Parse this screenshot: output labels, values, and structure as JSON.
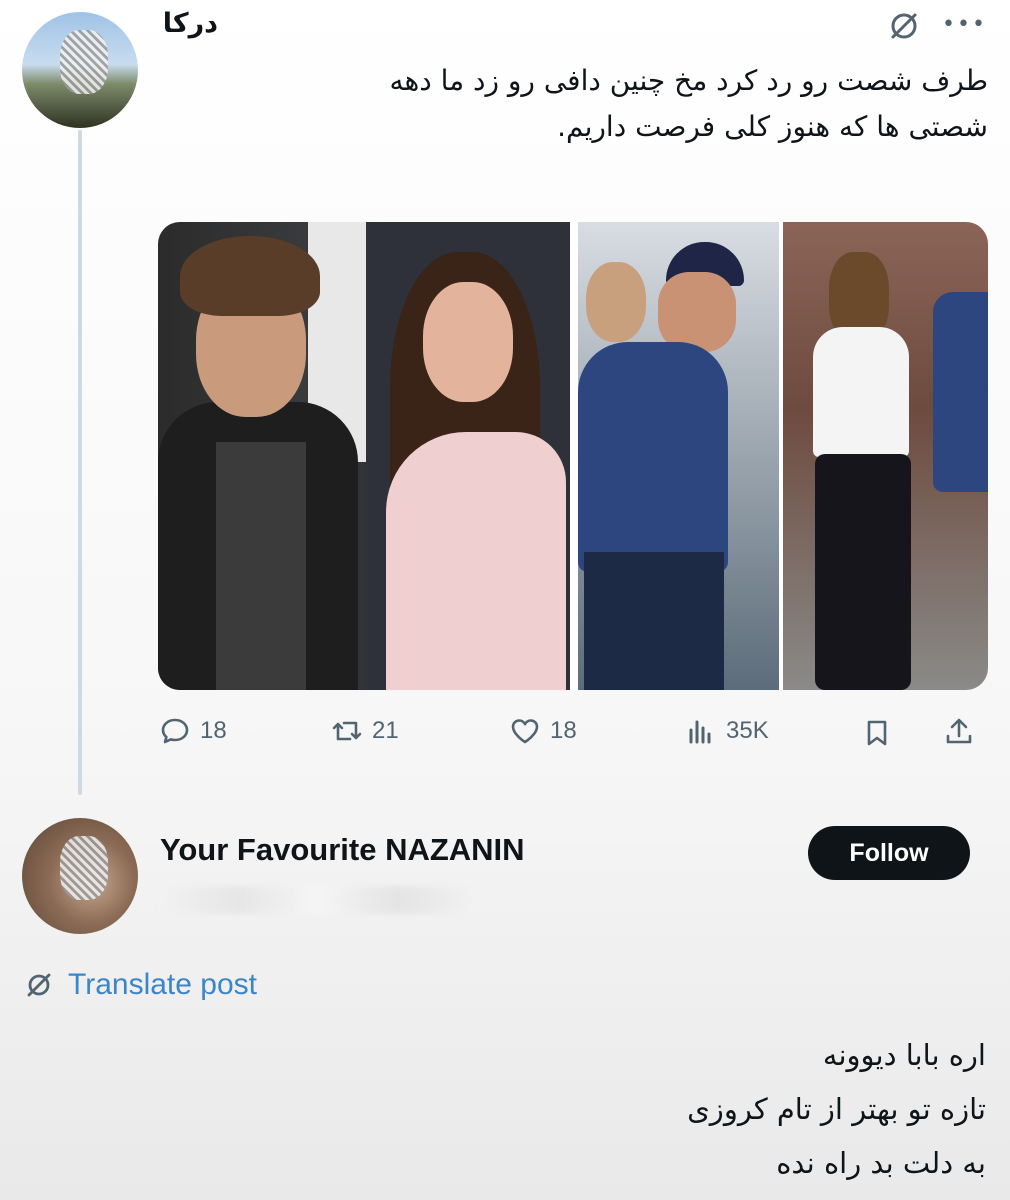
{
  "tweet": {
    "author_name": "درکا",
    "text_line_1": "طرف شصت رو رد کرد مخ چنین دافی رو زد ما دهه",
    "text_line_2": "شصتی ها که هنوز کلی فرصت داریم.",
    "stats": {
      "replies": "18",
      "reposts": "21",
      "likes": "18",
      "views": "35K"
    }
  },
  "reply": {
    "author_name": "Your Favourite NAZANIN",
    "follow_label": "Follow",
    "translate_label": "Translate post",
    "text_lines": [
      "اره بابا دیوونه",
      "تازه تو بهتر از تام کروزی",
      "به دلت بد راه نده"
    ]
  },
  "icons": {
    "grok": "grok-icon",
    "more": "more-icon",
    "reply": "reply-icon",
    "repost": "repost-icon",
    "like": "heart-icon",
    "views": "views-icon",
    "bookmark": "bookmark-icon",
    "share": "share-icon",
    "translate": "translate-icon"
  },
  "colors": {
    "text": "#0f1419",
    "muted": "#536471",
    "link": "#3a86c8",
    "follow_bg": "#0f1419"
  }
}
